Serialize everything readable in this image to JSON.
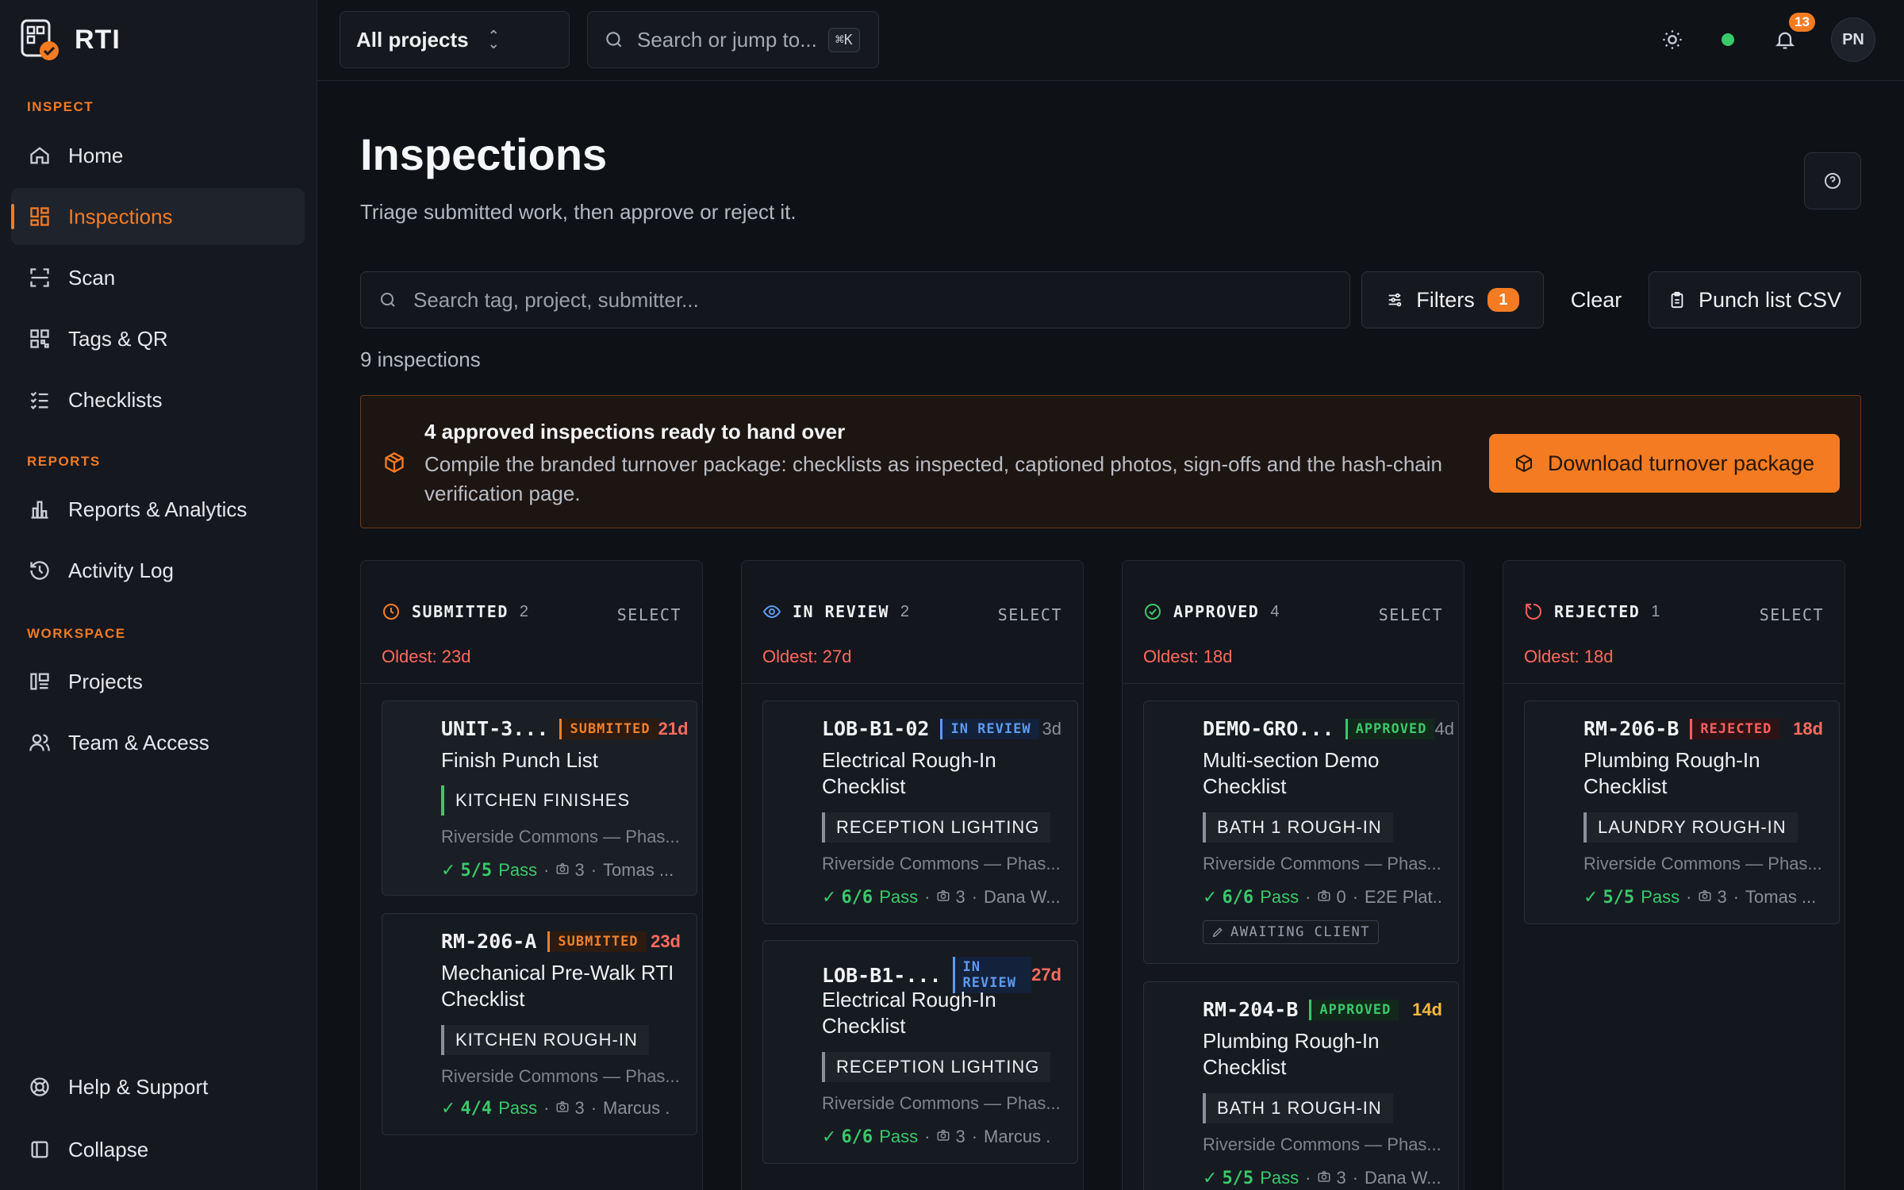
{
  "brand": {
    "name": "RTI"
  },
  "sidebar": {
    "sections": [
      {
        "label": "INSPECT",
        "items": [
          {
            "label": "Home",
            "icon": "home-icon"
          },
          {
            "label": "Inspections",
            "icon": "grid-icon",
            "active": true
          },
          {
            "label": "Scan",
            "icon": "scan-icon"
          },
          {
            "label": "Tags & QR",
            "icon": "qr-icon"
          },
          {
            "label": "Checklists",
            "icon": "checklist-icon"
          }
        ]
      },
      {
        "label": "REPORTS",
        "items": [
          {
            "label": "Reports & Analytics",
            "icon": "bar-chart-icon"
          },
          {
            "label": "Activity Log",
            "icon": "history-icon"
          }
        ]
      },
      {
        "label": "WORKSPACE",
        "items": [
          {
            "label": "Projects",
            "icon": "projects-icon"
          },
          {
            "label": "Team & Access",
            "icon": "users-icon"
          }
        ]
      }
    ],
    "help": "Help & Support",
    "collapse": "Collapse"
  },
  "topbar": {
    "project_select": "All projects",
    "search_placeholder": "Search or jump to...",
    "shortcut": "⌘K",
    "notifications": "13",
    "avatar_initials": "PN"
  },
  "page": {
    "title": "Inspections",
    "subtitle": "Triage submitted work, then approve or reject it.",
    "search_placeholder": "Search tag, project, submitter...",
    "filters_label": "Filters",
    "filters_count": "1",
    "clear_label": "Clear",
    "csv_label": "Punch list CSV",
    "count_text": "9 inspections"
  },
  "banner": {
    "title": "4 approved inspections ready to hand over",
    "description": "Compile the branded turnover package: checklists as inspected, captioned photos, sign-offs and the hash-chain verification page.",
    "button": "Download turnover package"
  },
  "columns": [
    {
      "title": "SUBMITTED",
      "count": "2",
      "select": "SELECT",
      "oldest": "Oldest: 23d",
      "icon": "clock-icon",
      "color": "#f0802c",
      "cards": [
        {
          "tag": "UNIT-3...",
          "status": "SUBMITTED",
          "age": "21d",
          "title": "Finish Punch List",
          "location": "KITCHEN FINISHES",
          "project": "Riverside Commons — Phas...",
          "pass": "5/5",
          "pass_label": "Pass",
          "photos": "3",
          "submitter": "Tomas ..."
        },
        {
          "tag": "RM-206-A",
          "status": "SUBMITTED",
          "age": "23d",
          "title": "Mechanical Pre-Walk RTI Checklist",
          "location": "KITCHEN ROUGH-IN",
          "project": "Riverside Commons — Phas...",
          "pass": "4/4",
          "pass_label": "Pass",
          "photos": "3",
          "submitter": "Marcus ."
        }
      ]
    },
    {
      "title": "IN REVIEW",
      "count": "2",
      "select": "SELECT",
      "oldest": "Oldest: 27d",
      "icon": "eye-icon",
      "color": "#5d9bf0",
      "cards": [
        {
          "tag": "LOB-B1-02",
          "status": "IN REVIEW",
          "age": "3d",
          "title": "Electrical Rough-In Checklist",
          "location": "RECEPTION LIGHTING",
          "project": "Riverside Commons — Phas...",
          "pass": "6/6",
          "pass_label": "Pass",
          "photos": "3",
          "submitter": "Dana W..."
        },
        {
          "tag": "LOB-B1-...",
          "status": "IN REVIEW",
          "age": "27d",
          "title": "Electrical Rough-In Checklist",
          "location": "RECEPTION LIGHTING",
          "project": "Riverside Commons — Phas...",
          "pass": "6/6",
          "pass_label": "Pass",
          "photos": "3",
          "submitter": "Marcus ."
        }
      ]
    },
    {
      "title": "APPROVED",
      "count": "4",
      "select": "SELECT",
      "oldest": "Oldest: 18d",
      "icon": "check-circle-icon",
      "color": "#3ac86b",
      "cards": [
        {
          "tag": "DEMO-GRO...",
          "status": "APPROVED",
          "age": "4d",
          "title": "Multi-section Demo Checklist",
          "location": "BATH 1 ROUGH-IN",
          "project": "Riverside Commons — Phas...",
          "pass": "6/6",
          "pass_label": "Pass",
          "photos": "0",
          "submitter": "E2E Plat...",
          "awaiting": "AWAITING CLIENT"
        },
        {
          "tag": "RM-204-B",
          "status": "APPROVED",
          "age": "14d",
          "title": "Plumbing Rough-In Checklist",
          "location": "BATH 1 ROUGH-IN",
          "project": "Riverside Commons — Phas...",
          "pass": "5/5",
          "pass_label": "Pass",
          "photos": "3",
          "submitter": "Dana W..."
        }
      ]
    },
    {
      "title": "REJECTED",
      "count": "1",
      "select": "SELECT",
      "oldest": "Oldest: 18d",
      "icon": "reject-icon",
      "color": "#ff5e5e",
      "cards": [
        {
          "tag": "RM-206-B",
          "status": "REJECTED",
          "age": "18d",
          "title": "Plumbing Rough-In Checklist",
          "location": "LAUNDRY ROUGH-IN",
          "project": "Riverside Commons — Phas...",
          "pass": "5/5",
          "pass_label": "Pass",
          "photos": "3",
          "submitter": "Tomas ..."
        }
      ]
    }
  ],
  "colors": {
    "accent": "#f47b22",
    "background": "#0e1116",
    "sidebar": "#15181e",
    "pass": "#3ac86b",
    "danger": "#ff6b5e"
  }
}
